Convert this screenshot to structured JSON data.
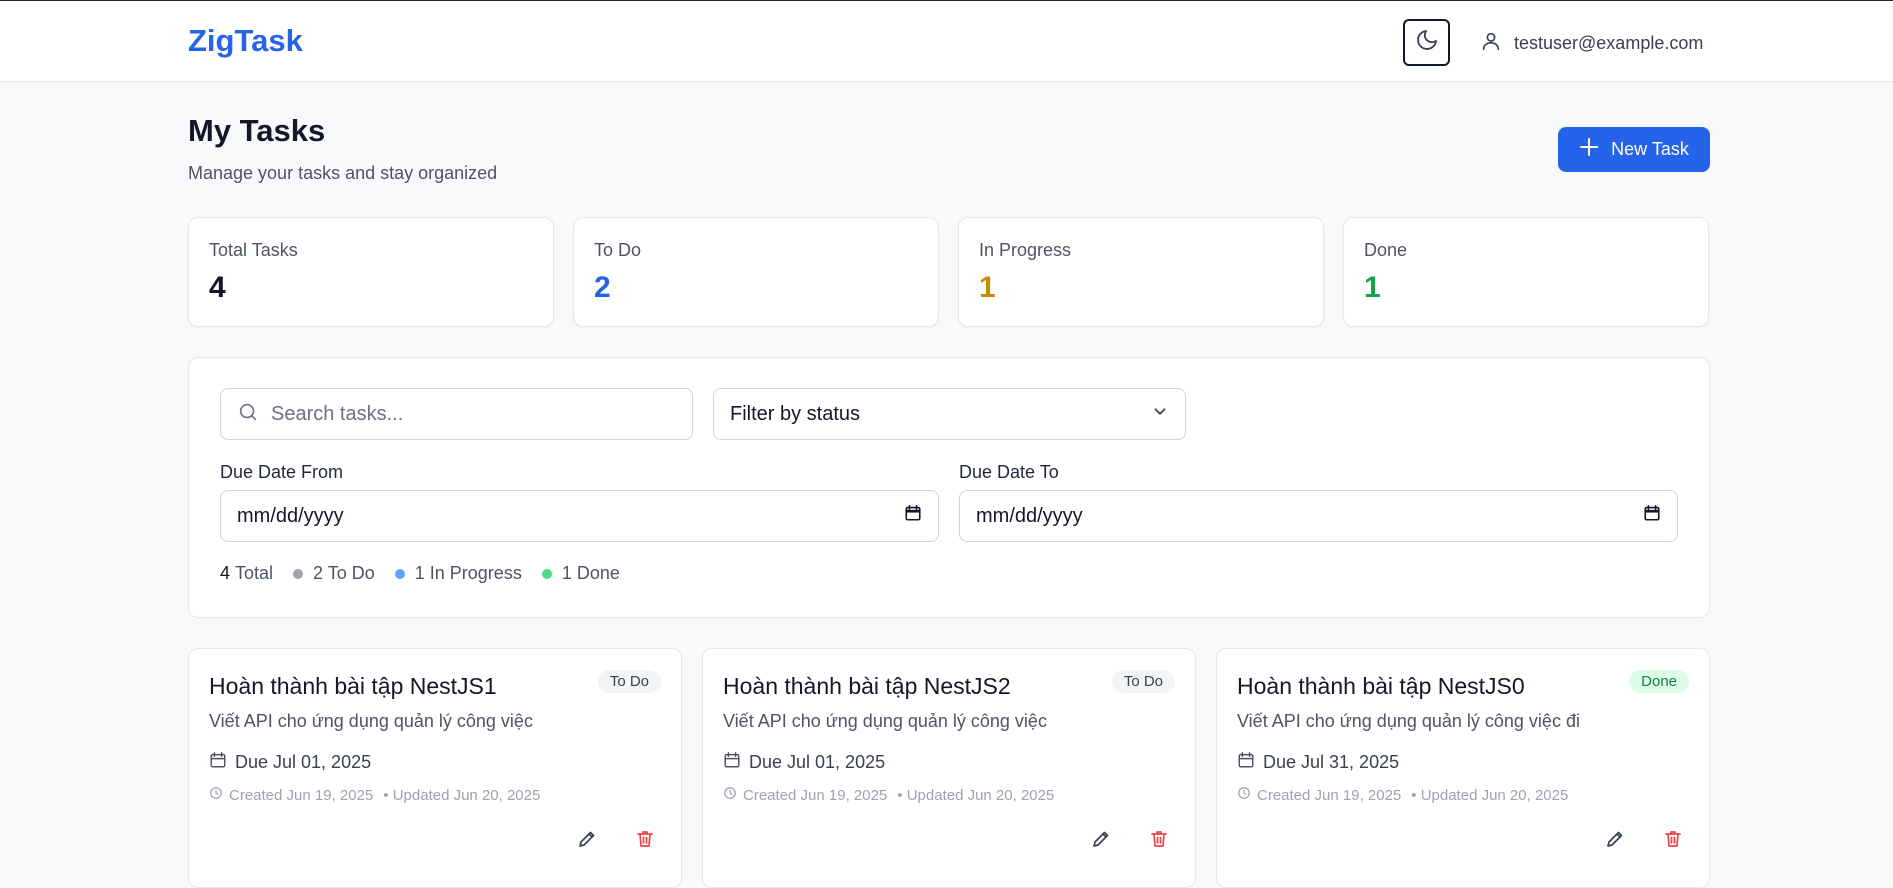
{
  "header": {
    "brand": "ZigTask",
    "user_email": "testuser@example.com",
    "icons": {
      "theme": "moon-icon",
      "user": "user-icon"
    }
  },
  "page": {
    "title": "My Tasks",
    "subtitle": "Manage your tasks and stay organized",
    "new_task_label": "New Task"
  },
  "stats": [
    {
      "label": "Total Tasks",
      "value": "4",
      "color": "#111827"
    },
    {
      "label": "To Do",
      "value": "2",
      "color": "#2563eb"
    },
    {
      "label": "In Progress",
      "value": "1",
      "color": "#ca8a04"
    },
    {
      "label": "Done",
      "value": "1",
      "color": "#16a34a"
    }
  ],
  "filters": {
    "search_placeholder": "Search tasks...",
    "status_value": "Filter by status",
    "due_from_label": "Due Date From",
    "due_from_value": "mm/dd/yyyy",
    "due_to_label": "Due Date To",
    "due_to_value": "mm/dd/yyyy",
    "summary": {
      "total_num": "4",
      "total_label": "Total",
      "todo": "2 To Do",
      "in_progress": "1 In Progress",
      "done": "1 Done",
      "dot_colors": {
        "todo": "#9ca3af",
        "in_progress": "#60a5fa",
        "done": "#4ade80"
      }
    }
  },
  "tasks": [
    {
      "title": "Hoàn thành bài tập NestJS1",
      "status": "To Do",
      "description": "Viết API cho ứng dụng quản lý công việc",
      "due": "Due Jul 01, 2025",
      "created": "Created Jun 19, 2025",
      "updated": "• Updated Jun 20, 2025"
    },
    {
      "title": "Hoàn thành bài tập NestJS2",
      "status": "To Do",
      "description": "Viết API cho ứng dụng quản lý công việc",
      "due": "Due Jul 01, 2025",
      "created": "Created Jun 19, 2025",
      "updated": "• Updated Jun 20, 2025"
    },
    {
      "title": "Hoàn thành bài tập NestJS0",
      "status": "Done",
      "description": "Viết API cho ứng dụng quản lý công việc đi",
      "due": "Due Jul 31, 2025",
      "created": "Created Jun 19, 2025",
      "updated": "• Updated Jun 20, 2025"
    }
  ],
  "badge_colors": {
    "todo": {
      "bg": "#f3f4f6",
      "fg": "#374151"
    },
    "done": {
      "bg": "#dcfce7",
      "fg": "#15803d"
    }
  }
}
